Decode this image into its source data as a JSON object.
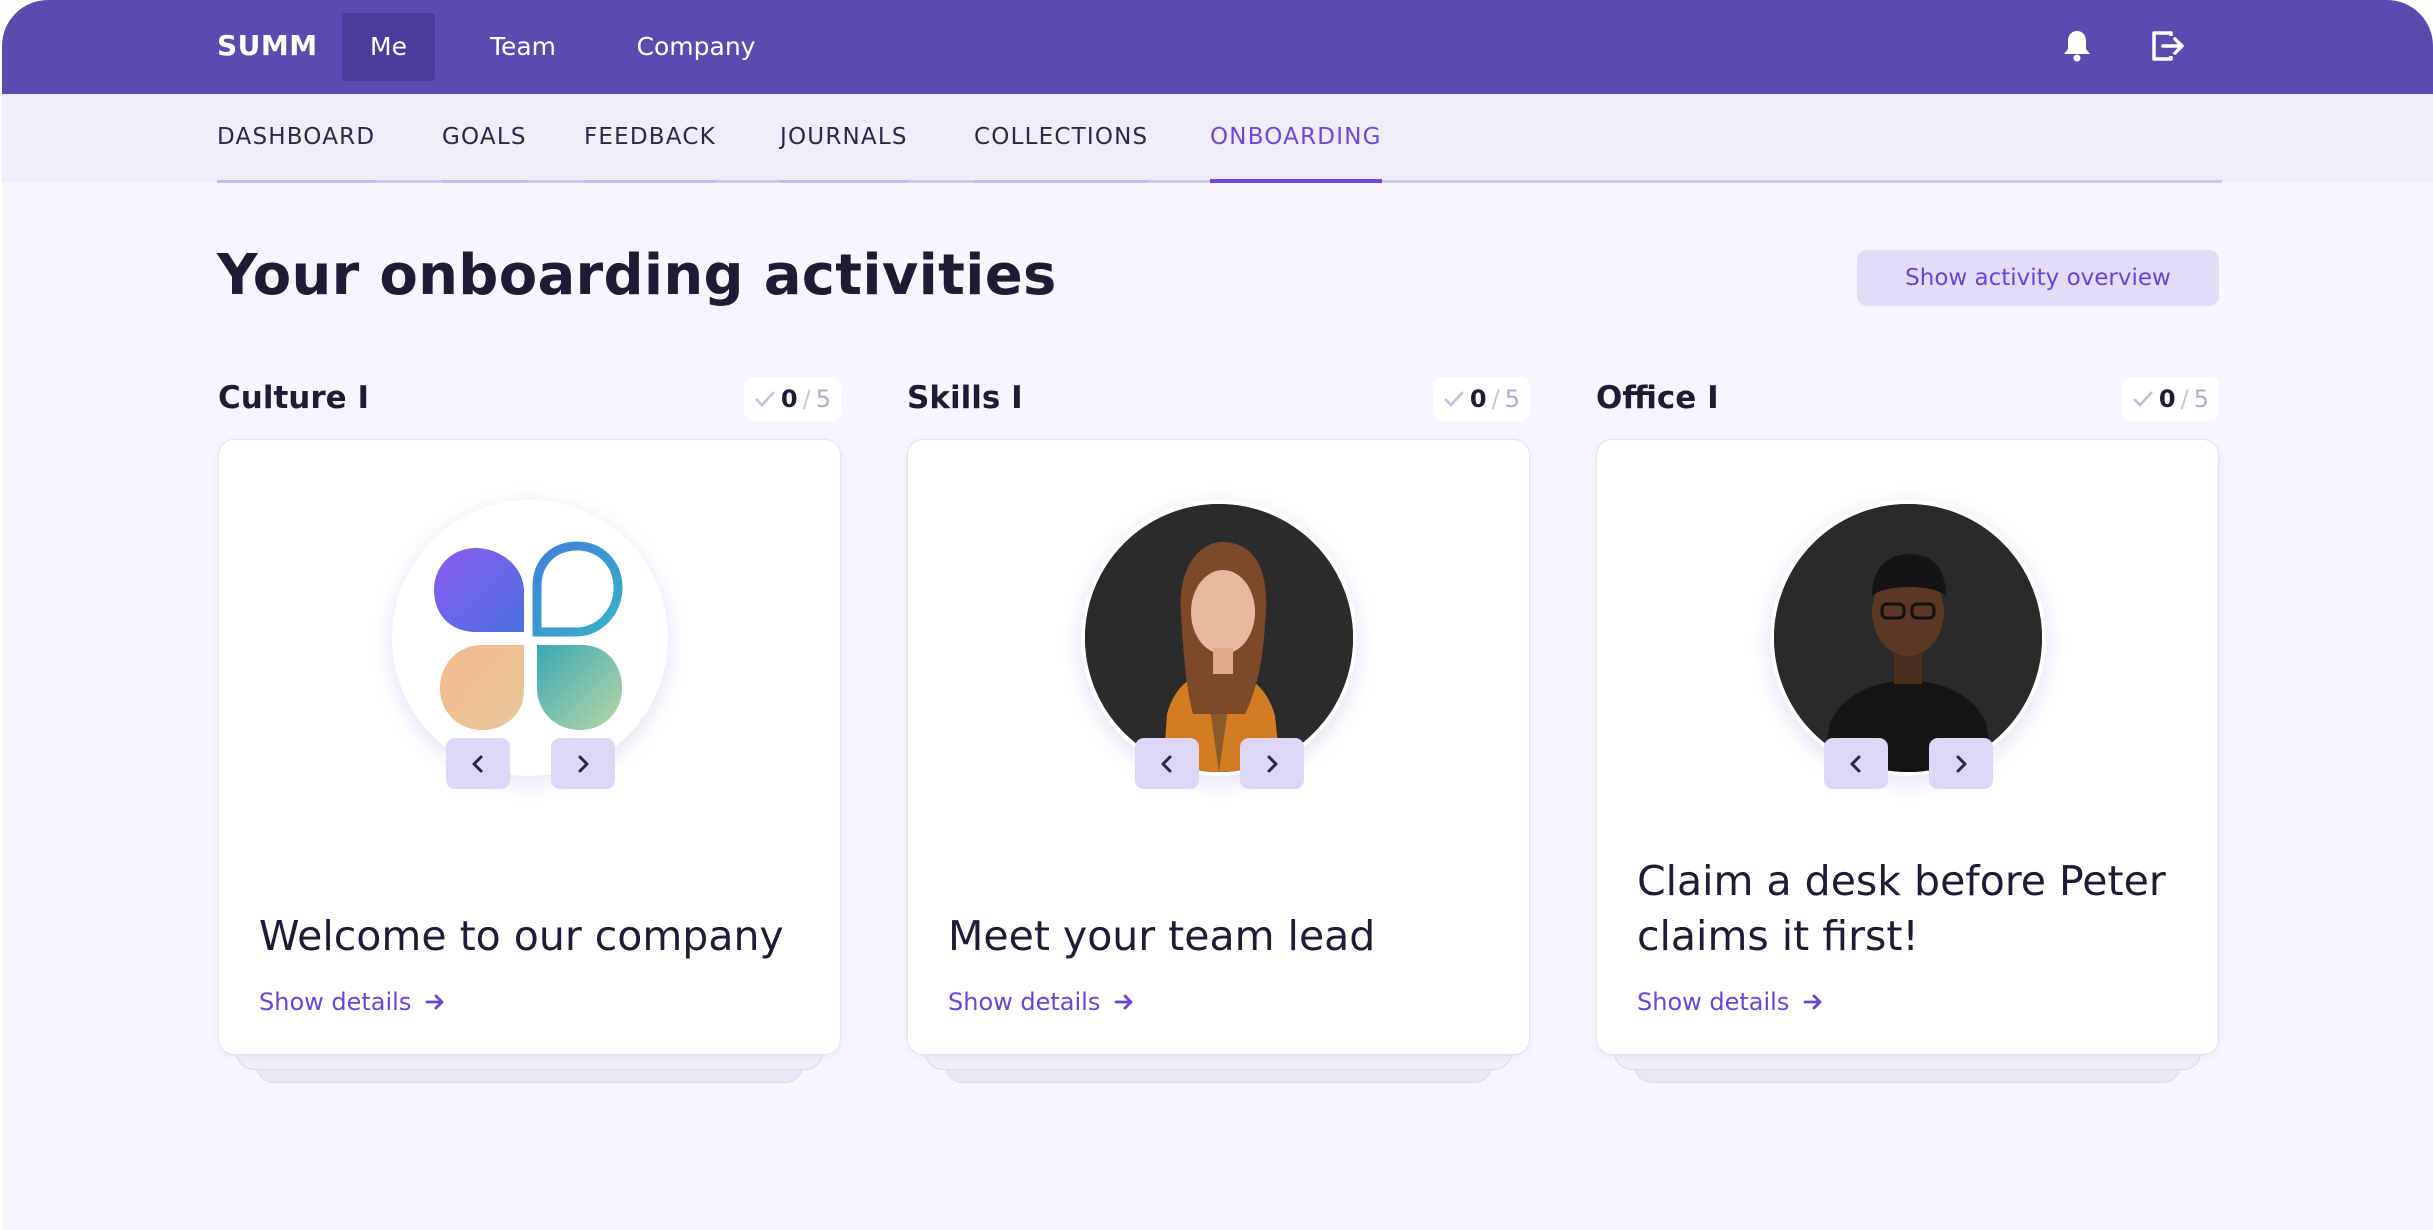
{
  "topbar": {
    "brand": "SUMM",
    "nav": [
      {
        "label": "Me",
        "active": true
      },
      {
        "label": "Team",
        "active": false
      },
      {
        "label": "Company",
        "active": false
      }
    ],
    "icons": [
      "bell-icon",
      "logout-icon"
    ]
  },
  "subnav": {
    "tabs": [
      {
        "label": "DASHBOARD",
        "active": false
      },
      {
        "label": "GOALS",
        "active": false
      },
      {
        "label": "FEEDBACK",
        "active": false
      },
      {
        "label": "JOURNALS",
        "active": false
      },
      {
        "label": "COLLECTIONS",
        "active": false
      },
      {
        "label": "ONBOARDING",
        "active": true
      }
    ]
  },
  "page": {
    "title": "Your onboarding activities",
    "overview_button": "Show activity overview"
  },
  "columns": [
    {
      "title": "Culture I",
      "done": "0",
      "slash": "/",
      "total": "5",
      "card": {
        "image": "company-logo",
        "title": "Welcome to our company",
        "link": "Show details"
      }
    },
    {
      "title": "Skills I",
      "done": "0",
      "slash": "/",
      "total": "5",
      "card": {
        "image": "team-lead-photo",
        "title": "Meet your team lead",
        "link": "Show details"
      }
    },
    {
      "title": "Office I",
      "done": "0",
      "slash": "/",
      "total": "5",
      "card": {
        "image": "colleague-photo",
        "title": "Claim a desk before Peter claims it first!",
        "link": "Show details"
      }
    }
  ],
  "colors": {
    "topbar": "#5c4aaf",
    "accent": "#7246d8",
    "background": "#f7f5fd",
    "button_bg": "#e2dcf8"
  }
}
